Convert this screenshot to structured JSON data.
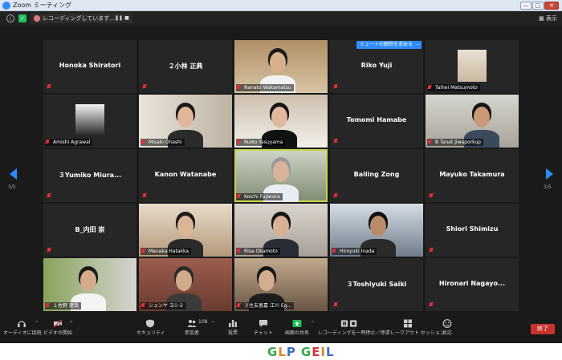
{
  "window": {
    "title": "Zoom ミーティング",
    "controls": [
      "—",
      "□",
      "✕"
    ]
  },
  "topbar": {
    "recording_text": "レコーディングしています…",
    "view_label": "表示"
  },
  "unmute_request": {
    "label": "ミュートの解除を求める",
    "more": "…"
  },
  "pagination": {
    "left": "3/5",
    "right": "3/5"
  },
  "tiles": [
    {
      "name": "Honoka Shiratori",
      "video": false
    },
    {
      "name": "２小林 正典",
      "video": false
    },
    {
      "name": "Nanato Wakamatsu",
      "video": true
    },
    {
      "name": "Riko Yuji",
      "video": false
    },
    {
      "name": "Taihei Matsumoto",
      "video": true
    },
    {
      "name": "Amishi Agrawal",
      "video": true
    },
    {
      "name": "Misaki Ohashi",
      "video": true
    },
    {
      "name": "Ruiko Yasuyama",
      "video": true
    },
    {
      "name": "Tomomi Hamabe",
      "video": false
    },
    {
      "name": "B Tanat Jiwaporkup",
      "video": true
    },
    {
      "name": "３Yumiko  Miura...",
      "video": false
    },
    {
      "name": "Kanon Watanabe",
      "video": false
    },
    {
      "name": "Koichi Fujiwara",
      "video": true,
      "active": true
    },
    {
      "name": "Bailing Zong",
      "video": false
    },
    {
      "name": "Mayuko Takamura",
      "video": false
    },
    {
      "name": "B_内田 崇",
      "video": false
    },
    {
      "name": "Manaka Hatakka",
      "video": true
    },
    {
      "name": "Risa Okamoto",
      "video": true
    },
    {
      "name": "Hiroyuki Inada",
      "video": true
    },
    {
      "name": "Shiori Shimizu",
      "video": false
    },
    {
      "name": "１佐野 遼哉",
      "video": true
    },
    {
      "name": "シュンヤ ヨシミ",
      "video": true
    },
    {
      "name": "３住友恵嘉 江川 Eg...",
      "video": true
    },
    {
      "name": "３Toshiyuki  Saiki",
      "video": false
    },
    {
      "name": "Hironari  Nagayo...",
      "video": false
    }
  ],
  "toolbar": {
    "audio": "オーディオに接続",
    "video": "ビデオの開始",
    "security": "セキュリティ",
    "participants": "参加者",
    "participants_count": "108",
    "polls": "投票",
    "chat": "チャット",
    "share": "画面の共有",
    "record": "レコーディングを一時停止／停止",
    "breakout": "ブレークアウト セッション",
    "reactions": "反応",
    "end": "終了"
  },
  "footer_logo": "GLP GEI L",
  "colors": {
    "accent": "#2d8cff",
    "end": "#c8332b",
    "muted": "#e0303a",
    "active_speaker": "#c8d44a",
    "share_green": "#23c15a"
  }
}
